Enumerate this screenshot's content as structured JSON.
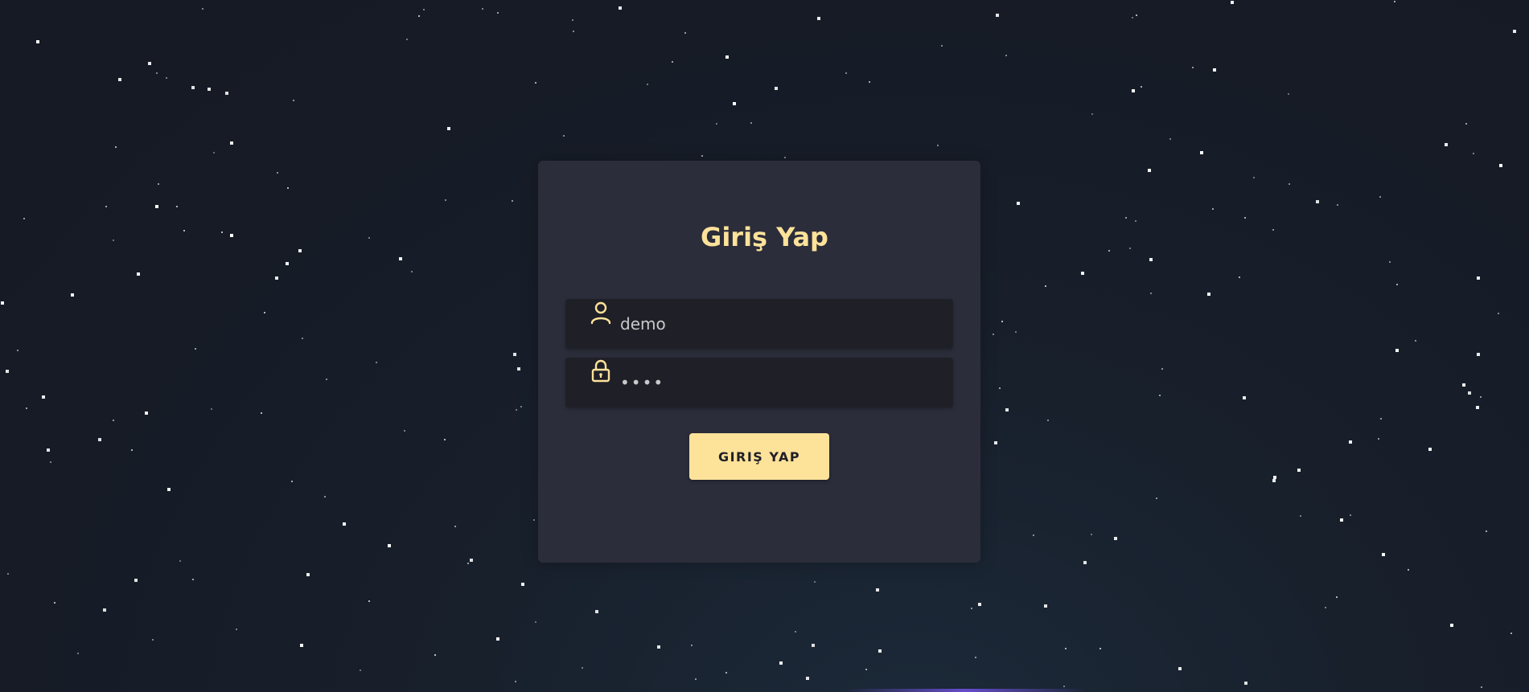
{
  "login": {
    "title": "Giriş Yap",
    "username_value": "demo",
    "password_value": "demo",
    "submit_label": "GIRIŞ YAP"
  },
  "icons": {
    "username": "user-icon",
    "password": "lock-icon"
  },
  "colors": {
    "accent": "#fde29a",
    "card_background": "#2b2d3a",
    "input_background": "#1f1f27",
    "page_background": "#161b26"
  }
}
